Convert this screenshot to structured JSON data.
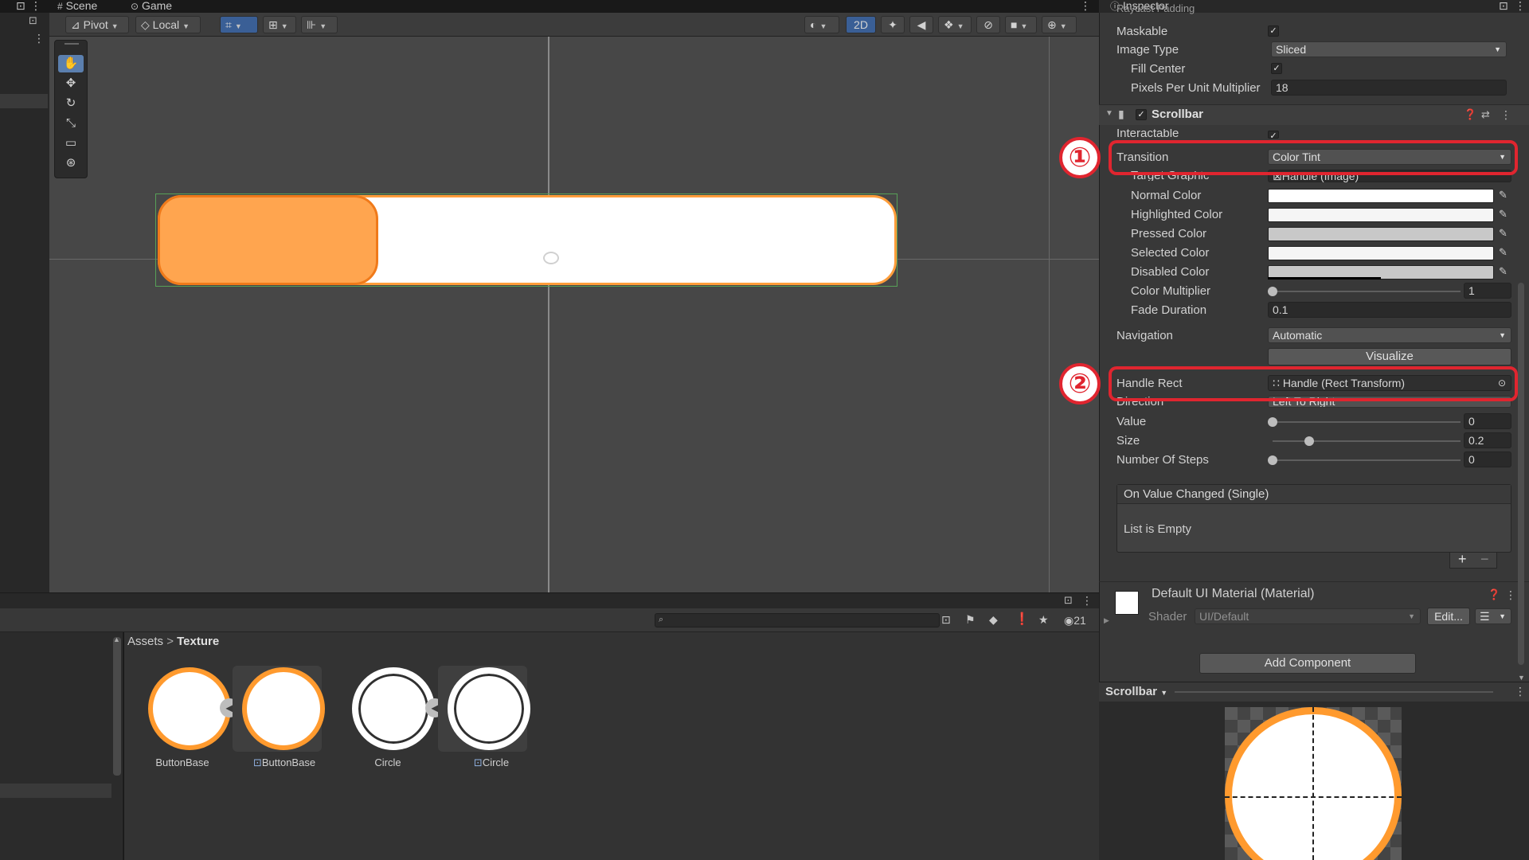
{
  "tabs": {
    "scene": "Scene",
    "game": "Game",
    "inspector": "Inspector"
  },
  "toolbar": {
    "pivot": "Pivot",
    "local": "Local",
    "mode_2d": "2D"
  },
  "project": {
    "breadcrumb_root": "Assets",
    "breadcrumb_sep": ">",
    "breadcrumb_current": "Texture",
    "visible_count": "21",
    "assets": [
      {
        "name": "ButtonBase"
      },
      {
        "name": "ButtonBase"
      },
      {
        "name": "Circle"
      },
      {
        "name": "Circle"
      }
    ]
  },
  "inspector": {
    "raycast_padding": "Raycast Padding",
    "maskable": "Maskable",
    "image_type": {
      "label": "Image Type",
      "value": "Sliced"
    },
    "fill_center": "Fill Center",
    "ppu_multiplier": {
      "label": "Pixels Per Unit Multiplier",
      "value": "18"
    },
    "scrollbar": {
      "title": "Scrollbar",
      "interactable": "Interactable",
      "transition": {
        "label": "Transition",
        "value": "Color Tint"
      },
      "target_graphic": {
        "label": "Target Graphic",
        "value": "Handle (Image)"
      },
      "colors": [
        {
          "label": "Normal Color",
          "hex": "#ffffff"
        },
        {
          "label": "Highlighted Color",
          "hex": "#f5f5f5"
        },
        {
          "label": "Pressed Color",
          "hex": "#c8c8c8"
        },
        {
          "label": "Selected Color",
          "hex": "#f5f5f5"
        },
        {
          "label": "Disabled Color",
          "hex": "#c8c8c8"
        }
      ],
      "color_multiplier": {
        "label": "Color Multiplier",
        "value": "1"
      },
      "fade_duration": {
        "label": "Fade Duration",
        "value": "0.1"
      },
      "navigation": {
        "label": "Navigation",
        "value": "Automatic"
      },
      "visualize": "Visualize",
      "handle_rect": {
        "label": "Handle Rect",
        "value": "Handle (Rect Transform)"
      },
      "direction": {
        "label": "Direction",
        "value": "Left To Right"
      },
      "value": {
        "label": "Value",
        "value": "0"
      },
      "size": {
        "label": "Size",
        "value": "0.2"
      },
      "number_of_steps": {
        "label": "Number Of Steps",
        "value": "0"
      },
      "on_value_changed": "On Value Changed (Single)",
      "list_empty": "List is Empty",
      "plus": "+",
      "minus": "−"
    },
    "material": {
      "title": "Default UI Material (Material)",
      "shader_label": "Shader",
      "shader_value": "UI/Default",
      "edit": "Edit..."
    },
    "add_component": "Add Component",
    "preview": {
      "title": "Scrollbar"
    }
  },
  "annotations": {
    "marker1": "①",
    "marker2": "②"
  },
  "colors": {
    "accent_red": "#e0252f",
    "handle_orange": "#ffa54f",
    "border_orange": "#ff9d3a"
  }
}
